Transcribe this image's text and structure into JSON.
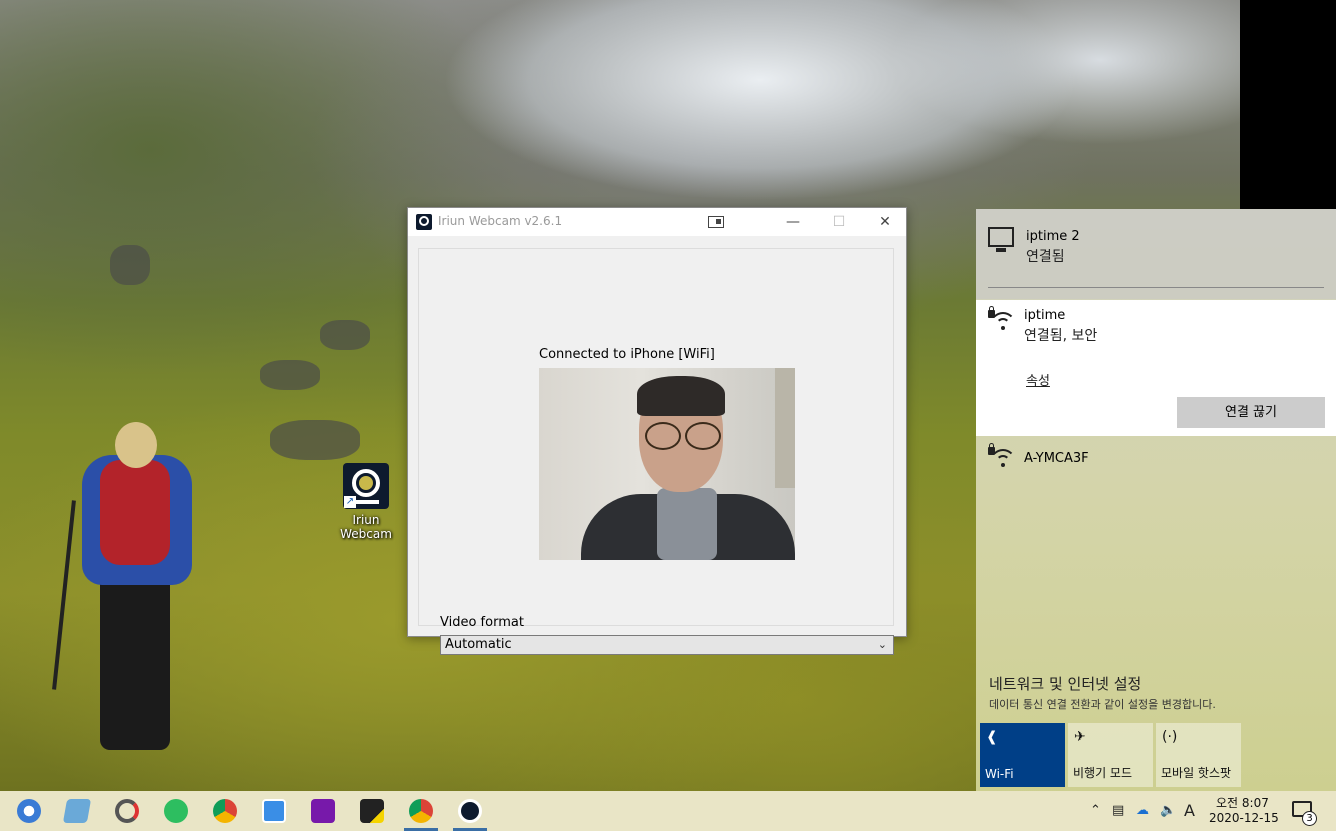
{
  "desktop": {
    "icon_label_line1": "Iriun",
    "icon_label_line2": "Webcam"
  },
  "app_window": {
    "title": "Iriun Webcam v2.6.1",
    "status": "Connected to iPhone [WiFi]",
    "video_format_label": "Video format",
    "video_format_value": "Automatic",
    "controls": {
      "minimize": "—",
      "maximize": "☐",
      "close": "✕"
    }
  },
  "network_flyout": {
    "wired": {
      "name": "iptime 2",
      "status": "연결됨"
    },
    "connected": {
      "name": "iptime",
      "status": "연결됨, 보안",
      "properties_link": "속성",
      "disconnect_button": "연결 끊기"
    },
    "other": {
      "name": "A-YMCA3F"
    },
    "settings_title": "네트워크 및 인터넷 설정",
    "settings_subtitle": "데이터 통신 연결 전환과 같이 설정을 변경합니다.",
    "quick_actions": [
      {
        "label": "Wi-Fi",
        "active": true,
        "icon": "wifi-icon"
      },
      {
        "label": "비행기 모드",
        "active": false,
        "icon": "airplane-icon"
      },
      {
        "label": "모바일 핫스팟",
        "active": false,
        "icon": "hotspot-icon"
      }
    ]
  },
  "taskbar": {
    "apps": [
      "browser-app",
      "notes-app",
      "recovery-app",
      "evernote",
      "chrome",
      "sticky-app",
      "onenote",
      "sticky-notes",
      "chrome",
      "iriun-webcam"
    ],
    "clock_time": "오전 8:07",
    "clock_date": "2020-12-15",
    "input_indicator": "A",
    "notification_count": "3",
    "colors": {
      "active_tile": "#003f87",
      "taskbar_bg": "#e9e5c6"
    }
  }
}
